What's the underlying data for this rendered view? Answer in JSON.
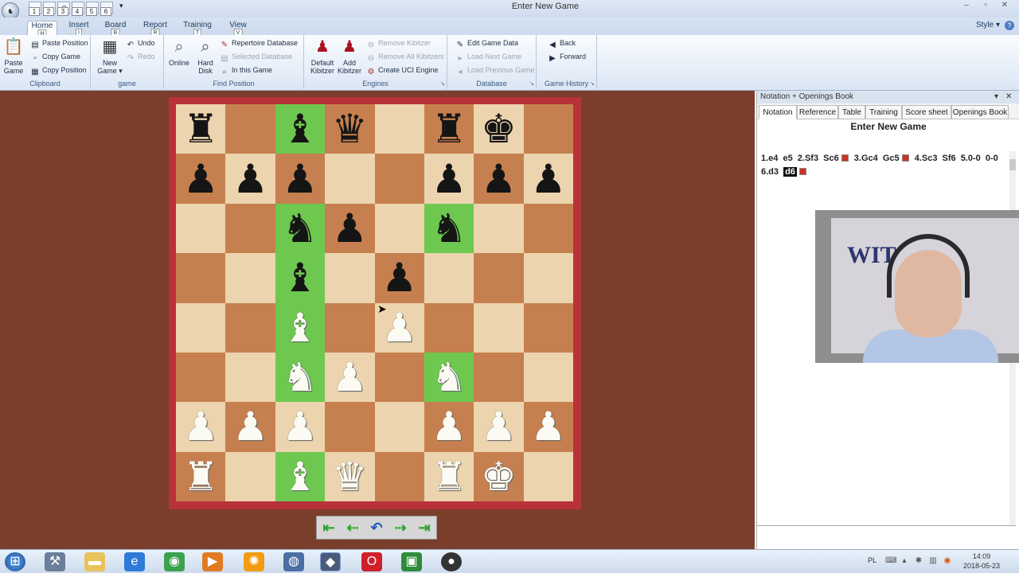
{
  "window": {
    "title": "Enter New Game",
    "quick_access": [
      "1",
      "2",
      "3",
      "4",
      "5",
      "6"
    ]
  },
  "tabs": [
    {
      "label": "Home",
      "key": "H"
    },
    {
      "label": "Insert",
      "key": "I"
    },
    {
      "label": "Board",
      "key": "B"
    },
    {
      "label": "Report",
      "key": "R"
    },
    {
      "label": "Training",
      "key": "T"
    },
    {
      "label": "View",
      "key": "V"
    }
  ],
  "style_menu": "Style",
  "ribbon": {
    "clipboard": {
      "paste_game": "Paste Game",
      "paste_position": "Paste Position",
      "copy_game": "Copy Game",
      "copy_position": "Copy Position",
      "label": "Clipboard"
    },
    "game": {
      "new_game": "New Game",
      "undo": "Undo",
      "redo": "Redo",
      "label": "game"
    },
    "find_position": {
      "online": "Online",
      "hard_disk": "Hard Disk",
      "repertoire_database": "Repertoire Database",
      "selected_database": "Selected Database",
      "in_this_game": "In this Game",
      "label": "Find Position"
    },
    "engines": {
      "default_kibitzer": "Default Kibitzer",
      "add_kibitzer": "Add Kibitzer",
      "remove_kibitzer": "Remove Kibitzer",
      "remove_all_kibitzers": "Remove All Kibitzers",
      "create_uci_engine": "Create UCI Engine",
      "label": "Engines"
    },
    "database": {
      "edit_game_data": "Edit Game Data",
      "load_next_game": "Load Next Game",
      "load_previous_game": "Load Previous Game",
      "label": "Database"
    },
    "game_history": {
      "back": "Back",
      "forward": "Forward",
      "label": "Game History"
    }
  },
  "board": {
    "rows": [
      [
        "r",
        "",
        "b",
        "q",
        "",
        "r",
        "k",
        ""
      ],
      [
        "p",
        "p",
        "p",
        "",
        "",
        "p",
        "p",
        "p"
      ],
      [
        "",
        "",
        "n",
        "p",
        "",
        "n",
        "",
        ""
      ],
      [
        "",
        "",
        "b",
        "",
        "p",
        "",
        "",
        ""
      ],
      [
        "",
        "",
        "B",
        "",
        "P",
        "",
        "",
        ""
      ],
      [
        "",
        "",
        "N",
        "P",
        "",
        "N",
        "",
        ""
      ],
      [
        "P",
        "P",
        "P",
        "",
        "",
        "P",
        "P",
        "P"
      ],
      [
        "R",
        "",
        "B",
        "Q",
        "",
        "R",
        "K",
        ""
      ]
    ],
    "highlighted": [
      [
        0,
        2
      ],
      [
        2,
        2
      ],
      [
        2,
        5
      ],
      [
        3,
        2
      ],
      [
        4,
        2
      ],
      [
        5,
        2
      ],
      [
        5,
        5
      ],
      [
        7,
        2
      ]
    ],
    "colors": {
      "light": "#ecd4ae",
      "dark": "#c6804f",
      "highlight": "#6ec850",
      "frame": "#b8323a"
    }
  },
  "nav_buttons": [
    "first-icon",
    "back-icon",
    "undo-icon",
    "forward-icon",
    "last-icon"
  ],
  "pane": {
    "header": "Notation + Openings Book",
    "tabs": [
      "Notation",
      "Reference",
      "Table",
      "Training",
      "Score sheet",
      "Openings Book"
    ],
    "game_title": "Enter New Game",
    "moves": [
      {
        "text": "1.e4"
      },
      {
        "text": "e5"
      },
      {
        "text": "2.Sf3"
      },
      {
        "text": "Sc6",
        "mark": true
      },
      {
        "text": "3.Gc4"
      },
      {
        "text": "Gc5",
        "mark": true
      },
      {
        "text": "4.Sc3"
      },
      {
        "text": "Sf6"
      },
      {
        "text": "5.0-0"
      },
      {
        "text": "0-0"
      },
      {
        "text": "6.d3"
      },
      {
        "text": "d6",
        "current": true,
        "mark": true
      }
    ]
  },
  "webcam": {
    "banner_text": "WIT"
  },
  "taskbar": {
    "language": "PL",
    "time": "14:09",
    "date": "2018-05-23"
  }
}
